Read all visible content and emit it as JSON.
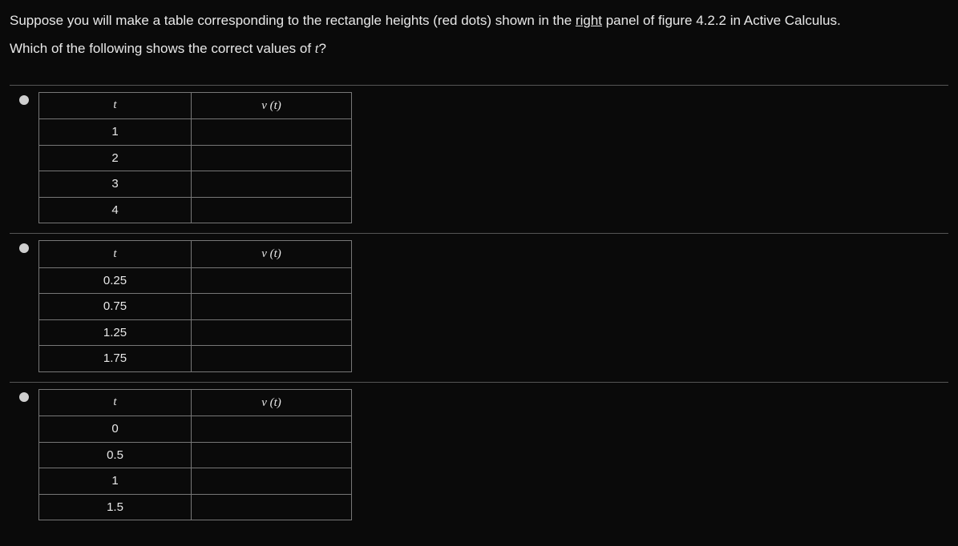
{
  "question": {
    "line1_pre": "Suppose you will make a table corresponding to the rectangle heights (red dots) shown in the ",
    "line1_underlined": "right",
    "line1_post": " panel of figure 4.2.2 in Active Calculus.",
    "line2_pre": "Which of the following shows the correct values of ",
    "line2_var": "t",
    "line2_post": "?"
  },
  "headers": {
    "t": "t",
    "v_pre": "v",
    "v_paren": " (t)"
  },
  "options": [
    {
      "t_values": [
        "1",
        "2",
        "3",
        "4"
      ]
    },
    {
      "t_values": [
        "0.25",
        "0.75",
        "1.25",
        "1.75"
      ]
    },
    {
      "t_values": [
        "0",
        "0.5",
        "1",
        "1.5"
      ]
    }
  ]
}
